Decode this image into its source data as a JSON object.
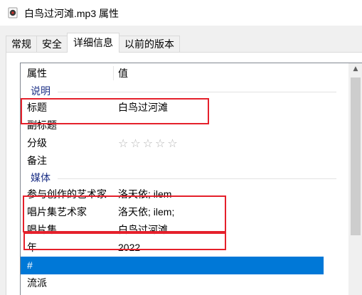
{
  "window": {
    "title": "白鸟过河滩.mp3 属性",
    "icon": "audio-file-icon"
  },
  "tabs": [
    {
      "label": "常规",
      "active": false
    },
    {
      "label": "安全",
      "active": false
    },
    {
      "label": "详细信息",
      "active": true
    },
    {
      "label": "以前的版本",
      "active": false
    }
  ],
  "details": {
    "columns": {
      "property": "属性",
      "value": "值"
    },
    "groups": {
      "description": "说明",
      "media": "媒体"
    },
    "rows": {
      "title": {
        "property": "标题",
        "value": "白鸟过河滩"
      },
      "subtitle": {
        "property": "副标题",
        "value": ""
      },
      "rating": {
        "property": "分级",
        "value": "☆☆☆☆☆",
        "stars_filled": 0,
        "stars_total": 5
      },
      "comments": {
        "property": "备注",
        "value": ""
      },
      "contributing_artists": {
        "property": "参与创作的艺术家",
        "value": "洛天依; ilem"
      },
      "album_artist": {
        "property": "唱片集艺术家",
        "value": "洛天依; ilem;"
      },
      "album": {
        "property": "唱片集",
        "value": "白鸟过河滩"
      },
      "year": {
        "property": "年",
        "value": "2022"
      },
      "track_number": {
        "property": "#",
        "value": ""
      },
      "genre": {
        "property": "流派",
        "value": ""
      }
    }
  },
  "colors": {
    "highlight_box": "#e5202b",
    "selection": "#0078d7",
    "group_text": "#1e3287"
  },
  "scroll": {
    "up_arrow": "▲"
  }
}
